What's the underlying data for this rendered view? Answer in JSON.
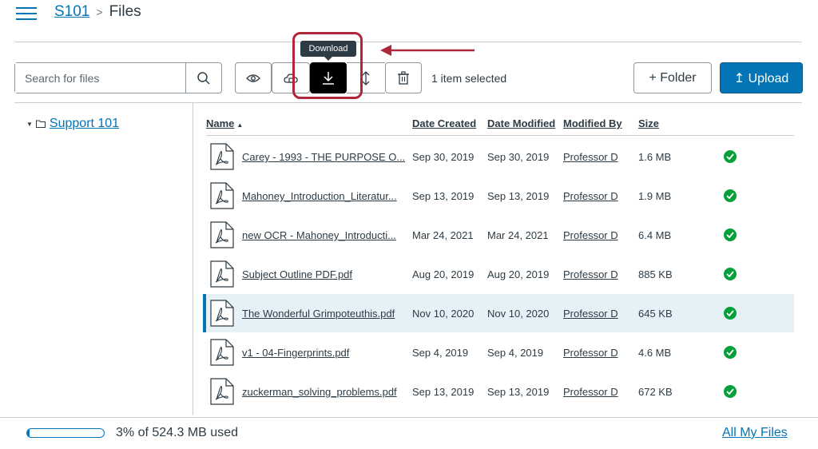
{
  "header": {
    "course": "S101",
    "separator": ">",
    "current": "Files"
  },
  "toolbar": {
    "search_placeholder": "Search for files",
    "selection_text": "1 item selected",
    "folder_label": "+ Folder",
    "upload_label": "↥ Upload",
    "tooltip": "Download"
  },
  "sidebar": {
    "tree": [
      {
        "label": "Support 101",
        "expanded": true
      }
    ]
  },
  "table": {
    "columns": {
      "name": "Name",
      "date_created": "Date Created",
      "date_modified": "Date Modified",
      "modified_by": "Modified By",
      "size": "Size"
    },
    "rows": [
      {
        "name": "Carey - 1993 - THE PURPOSE O...",
        "date_created": "Sep 30, 2019",
        "date_modified": "Sep 30, 2019",
        "modified_by": "Professor D",
        "size": "1.6 MB",
        "selected": false
      },
      {
        "name": "Mahoney_Introduction_Literatur...",
        "date_created": "Sep 13, 2019",
        "date_modified": "Sep 13, 2019",
        "modified_by": "Professor D",
        "size": "1.9 MB",
        "selected": false
      },
      {
        "name": "new OCR - Mahoney_Introducti...",
        "date_created": "Mar 24, 2021",
        "date_modified": "Mar 24, 2021",
        "modified_by": "Professor D",
        "size": "6.4 MB",
        "selected": false
      },
      {
        "name": "Subject Outline PDF.pdf",
        "date_created": "Aug 20, 2019",
        "date_modified": "Aug 20, 2019",
        "modified_by": "Professor D",
        "size": "885 KB",
        "selected": false
      },
      {
        "name": "The Wonderful Grimpoteuthis.pdf",
        "date_created": "Nov 10, 2020",
        "date_modified": "Nov 10, 2020",
        "modified_by": "Professor D",
        "size": "645 KB",
        "selected": true
      },
      {
        "name": "v1 - 04-Fingerprints.pdf",
        "date_created": "Sep 4, 2019",
        "date_modified": "Sep 4, 2019",
        "modified_by": "Professor D",
        "size": "4.6 MB",
        "selected": false
      },
      {
        "name": "zuckerman_solving_problems.pdf",
        "date_created": "Sep 13, 2019",
        "date_modified": "Sep 13, 2019",
        "modified_by": "Professor D",
        "size": "672 KB",
        "selected": false
      }
    ]
  },
  "footer": {
    "quota_text": "3% of 524.3 MB used",
    "quota_percent": 3,
    "all_files": "All My Files"
  },
  "colors": {
    "brand": "#0374b5",
    "text": "#2d3b45",
    "published": "#06a03b",
    "annotation": "#b0263b"
  }
}
